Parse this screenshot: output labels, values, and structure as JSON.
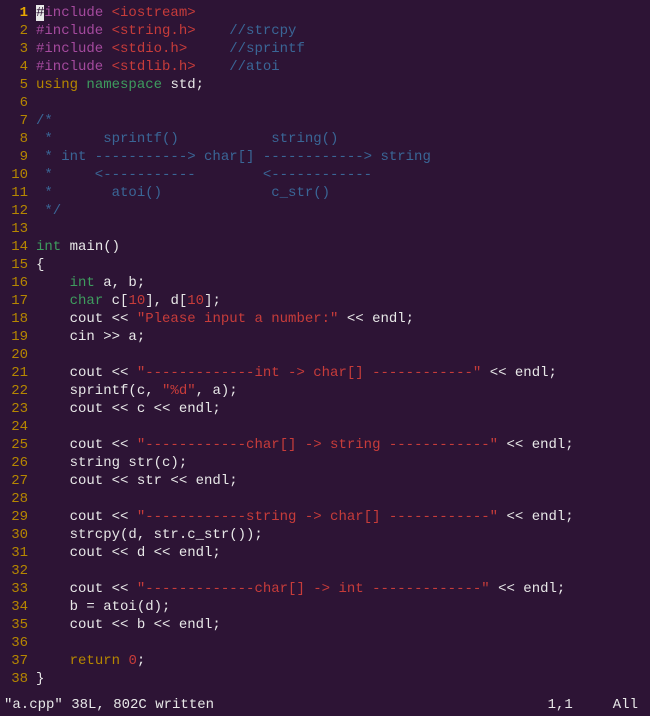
{
  "lines": [
    {
      "n": "1",
      "current": true,
      "tokens": [
        {
          "t": "cursor",
          "v": "#"
        },
        {
          "t": "preproc",
          "v": "include "
        },
        {
          "t": "include",
          "v": "<iostream>"
        }
      ]
    },
    {
      "n": "2",
      "tokens": [
        {
          "t": "preproc",
          "v": "#include "
        },
        {
          "t": "include",
          "v": "<string.h>"
        },
        {
          "t": "normal",
          "v": "    "
        },
        {
          "t": "comment",
          "v": "//strcpy"
        }
      ]
    },
    {
      "n": "3",
      "tokens": [
        {
          "t": "preproc",
          "v": "#include "
        },
        {
          "t": "include",
          "v": "<stdio.h>"
        },
        {
          "t": "normal",
          "v": "     "
        },
        {
          "t": "comment",
          "v": "//sprintf"
        }
      ]
    },
    {
      "n": "4",
      "tokens": [
        {
          "t": "preproc",
          "v": "#include "
        },
        {
          "t": "include",
          "v": "<stdlib.h>"
        },
        {
          "t": "normal",
          "v": "    "
        },
        {
          "t": "comment",
          "v": "//atoi"
        }
      ]
    },
    {
      "n": "5",
      "tokens": [
        {
          "t": "keyword",
          "v": "using"
        },
        {
          "t": "normal",
          "v": " "
        },
        {
          "t": "type",
          "v": "namespace"
        },
        {
          "t": "normal",
          "v": " std;"
        }
      ]
    },
    {
      "n": "6",
      "tokens": []
    },
    {
      "n": "7",
      "tokens": [
        {
          "t": "comment",
          "v": "/*"
        }
      ]
    },
    {
      "n": "8",
      "tokens": [
        {
          "t": "comment",
          "v": " *      sprintf()           string()"
        }
      ]
    },
    {
      "n": "9",
      "tokens": [
        {
          "t": "comment",
          "v": " * int -----------> char[] ------------> string"
        }
      ]
    },
    {
      "n": "10",
      "tokens": [
        {
          "t": "comment",
          "v": " *     <-----------        <------------"
        }
      ]
    },
    {
      "n": "11",
      "tokens": [
        {
          "t": "comment",
          "v": " *       atoi()             c_str()"
        }
      ]
    },
    {
      "n": "12",
      "tokens": [
        {
          "t": "comment",
          "v": " */"
        }
      ]
    },
    {
      "n": "13",
      "tokens": []
    },
    {
      "n": "14",
      "tokens": [
        {
          "t": "type",
          "v": "int"
        },
        {
          "t": "normal",
          "v": " main()"
        }
      ]
    },
    {
      "n": "15",
      "tokens": [
        {
          "t": "normal",
          "v": "{"
        }
      ]
    },
    {
      "n": "16",
      "tokens": [
        {
          "t": "normal",
          "v": "    "
        },
        {
          "t": "type",
          "v": "int"
        },
        {
          "t": "normal",
          "v": " a, b;"
        }
      ]
    },
    {
      "n": "17",
      "tokens": [
        {
          "t": "normal",
          "v": "    "
        },
        {
          "t": "type",
          "v": "char"
        },
        {
          "t": "normal",
          "v": " c["
        },
        {
          "t": "number",
          "v": "10"
        },
        {
          "t": "normal",
          "v": "], d["
        },
        {
          "t": "number",
          "v": "10"
        },
        {
          "t": "normal",
          "v": "];"
        }
      ]
    },
    {
      "n": "18",
      "tokens": [
        {
          "t": "normal",
          "v": "    cout << "
        },
        {
          "t": "string",
          "v": "\"Please input a number:\""
        },
        {
          "t": "normal",
          "v": " << endl;"
        }
      ]
    },
    {
      "n": "19",
      "tokens": [
        {
          "t": "normal",
          "v": "    cin >> a;"
        }
      ]
    },
    {
      "n": "20",
      "tokens": []
    },
    {
      "n": "21",
      "tokens": [
        {
          "t": "normal",
          "v": "    cout << "
        },
        {
          "t": "string",
          "v": "\"-------------int -> char[] ------------\""
        },
        {
          "t": "normal",
          "v": " << endl;"
        }
      ]
    },
    {
      "n": "22",
      "tokens": [
        {
          "t": "normal",
          "v": "    sprintf(c, "
        },
        {
          "t": "string",
          "v": "\"%d\""
        },
        {
          "t": "normal",
          "v": ", a);"
        }
      ]
    },
    {
      "n": "23",
      "tokens": [
        {
          "t": "normal",
          "v": "    cout << c << endl;"
        }
      ]
    },
    {
      "n": "24",
      "tokens": []
    },
    {
      "n": "25",
      "tokens": [
        {
          "t": "normal",
          "v": "    cout << "
        },
        {
          "t": "string",
          "v": "\"------------char[] -> string ------------\""
        },
        {
          "t": "normal",
          "v": " << endl;"
        }
      ]
    },
    {
      "n": "26",
      "tokens": [
        {
          "t": "normal",
          "v": "    string str(c);"
        }
      ]
    },
    {
      "n": "27",
      "tokens": [
        {
          "t": "normal",
          "v": "    cout << str << endl;"
        }
      ]
    },
    {
      "n": "28",
      "tokens": []
    },
    {
      "n": "29",
      "tokens": [
        {
          "t": "normal",
          "v": "    cout << "
        },
        {
          "t": "string",
          "v": "\"------------string -> char[] ------------\""
        },
        {
          "t": "normal",
          "v": " << endl;"
        }
      ]
    },
    {
      "n": "30",
      "tokens": [
        {
          "t": "normal",
          "v": "    strcpy(d, str.c_str());"
        }
      ]
    },
    {
      "n": "31",
      "tokens": [
        {
          "t": "normal",
          "v": "    cout << d << endl;"
        }
      ]
    },
    {
      "n": "32",
      "tokens": []
    },
    {
      "n": "33",
      "tokens": [
        {
          "t": "normal",
          "v": "    cout << "
        },
        {
          "t": "string",
          "v": "\"-------------char[] -> int -------------\""
        },
        {
          "t": "normal",
          "v": " << endl;"
        }
      ]
    },
    {
      "n": "34",
      "tokens": [
        {
          "t": "normal",
          "v": "    b = atoi(d);"
        }
      ]
    },
    {
      "n": "35",
      "tokens": [
        {
          "t": "normal",
          "v": "    cout << b << endl;"
        }
      ]
    },
    {
      "n": "36",
      "tokens": []
    },
    {
      "n": "37",
      "tokens": [
        {
          "t": "normal",
          "v": "    "
        },
        {
          "t": "keyword",
          "v": "return"
        },
        {
          "t": "normal",
          "v": " "
        },
        {
          "t": "number",
          "v": "0"
        },
        {
          "t": "normal",
          "v": ";"
        }
      ]
    },
    {
      "n": "38",
      "tokens": [
        {
          "t": "normal",
          "v": "}"
        }
      ]
    }
  ],
  "status": {
    "left": "\"a.cpp\" 38L, 802C written",
    "pos": "1,1",
    "right": "All"
  }
}
